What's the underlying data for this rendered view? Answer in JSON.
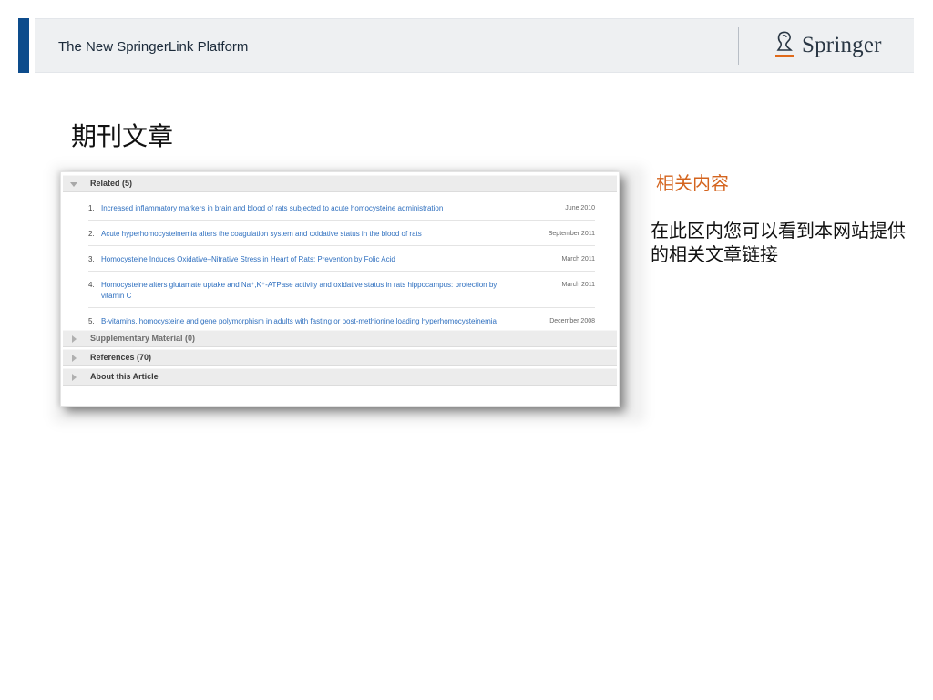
{
  "header": {
    "title": "The New SpringerLink Platform",
    "brand": "Springer",
    "accent_color": "#0d4c8c"
  },
  "slide": {
    "heading": "期刊文章"
  },
  "screenshot": {
    "related_label": "Related (5)",
    "related_items": [
      {
        "num": "1.",
        "title": "Increased inflammatory markers in brain and blood of rats subjected to acute homocysteine administration",
        "date": "June 2010"
      },
      {
        "num": "2.",
        "title": "Acute hyperhomocysteinemia alters the coagulation system and oxidative status in the blood of rats",
        "date": "September 2011"
      },
      {
        "num": "3.",
        "title": "Homocysteine Induces Oxidative–Nitrative Stress in Heart of Rats: Prevention by Folic Acid",
        "date": "March 2011"
      },
      {
        "num": "4.",
        "title": "Homocysteine alters glutamate uptake and Na⁺,K⁺-ATPase activity and oxidative status in rats hippocampus: protection by vitamin C",
        "date": "March 2011"
      },
      {
        "num": "5.",
        "title": "B-vitamins, homocysteine and gene polymorphism in adults with fasting or post-methionine loading hyperhomocysteinemia",
        "date": "December 2008"
      }
    ],
    "supplementary_label": "Supplementary Material (0)",
    "references_label": "References (70)",
    "about_label": "About this Article",
    "link_color": "#2e6fbf"
  },
  "note": {
    "title": "相关内容",
    "body": "在此区内您可以看到本网站提供的相关文章链接",
    "title_color": "#d4641e"
  }
}
